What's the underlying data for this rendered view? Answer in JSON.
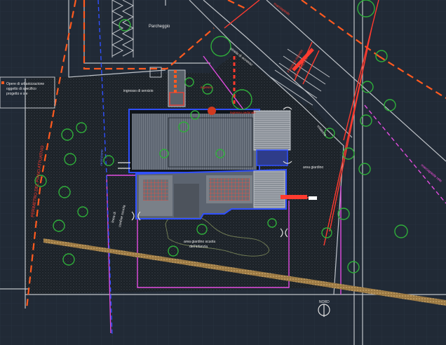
{
  "colors": {
    "background": "#212a36",
    "grid": "#2b3544",
    "hatch": "#1a1f24",
    "red": "#ff3b2f",
    "orange": "#ff5a1f",
    "magenta": "#e24ce0",
    "blue": "#3050ff",
    "green": "#2fae3a",
    "grey": "#bfc3c8",
    "path": "#b8925a"
  },
  "legend": {
    "swatch_color": "#ff5a1f",
    "text_line1": "Opere di urbanizzazione",
    "text_line2": "oggetto di specifico",
    "text_line3": "progetto  e s e"
  },
  "labels": {
    "parcheggio": "Parcheggio",
    "ingresso_servizio": "ingresso di servizio",
    "area_giardino_est": "area giardino",
    "area_giardino_sud_1": "area giardino scuola",
    "area_giardino_sud_2": "dell'infanzia",
    "perimetro": "PERIMETRO DEL PIANO ATTUATIVO",
    "linea_confine_1": "linea di",
    "linea_confine_2": "confine scuola",
    "nord": "NORD",
    "top_red_1": "marciapiede",
    "top_red_2": "Fascia di rispetto",
    "top_red_3": "di marciapiede",
    "road_label": "strada di accesso",
    "mag_right": "marciapiede rete",
    "blue_left": "recinzione",
    "red_note_1": "ingresso",
    "red_note_2": "ingresso pedonale",
    "curve_label": "rotatoria"
  }
}
